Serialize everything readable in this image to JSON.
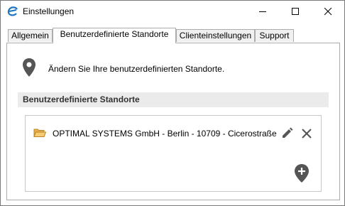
{
  "window": {
    "title": "Einstellungen",
    "app_icon": "e-logo-icon",
    "controls": [
      "minimize-icon",
      "maximize-icon",
      "close-icon"
    ]
  },
  "tabs": [
    {
      "label": "Allgemein",
      "active": false
    },
    {
      "label": "Benutzerdefinierte Standorte",
      "active": true
    },
    {
      "label": "Clienteinstellungen",
      "active": false
    },
    {
      "label": "Support",
      "active": false
    }
  ],
  "info": {
    "icon": "location-pin-icon",
    "text": "Ändern Sie Ihre benutzerdefinierten Standorte."
  },
  "section": {
    "title": "Benutzerdefinierte Standorte"
  },
  "locations": [
    {
      "icon": "folder-icon",
      "text": "OPTIMAL SYSTEMS GmbH - Berlin - 10709 - Cicerostraße ..."
    }
  ],
  "colors": {
    "accent": "#1e73be",
    "icon_gray": "#555555",
    "folder": "#e8b04a",
    "section_bg": "#ebebeb"
  }
}
